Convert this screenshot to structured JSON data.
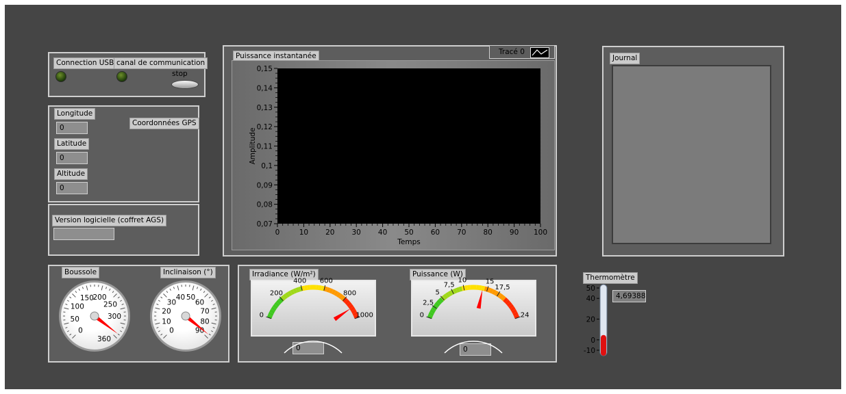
{
  "usb_panel": {
    "usb_label": "Connection USB",
    "channel_label": "canal de communication",
    "stop_label": "stop"
  },
  "gps_panel": {
    "title": "Coordonnées GPS",
    "longitude_label": "Longitude",
    "longitude_value": "0",
    "latitude_label": "Latitude",
    "latitude_value": "0",
    "altitude_label": "Altitude",
    "altitude_value": "0"
  },
  "version_panel": {
    "label": "Version logicielle (coffret AGS)",
    "value": ""
  },
  "compass_panel": {
    "boussole_label": "Boussole",
    "boussole_ticks": [
      "0",
      "50",
      "100",
      "150",
      "200",
      "250",
      "300",
      "360"
    ],
    "boussole_value": 350,
    "inclinaison_label": "Inclinaison (°)",
    "inclinaison_ticks": [
      "0",
      "10",
      "20",
      "30",
      "40",
      "50",
      "60",
      "70",
      "80",
      "90"
    ],
    "inclinaison_value": 88
  },
  "chart_panel": {
    "title": "Puissance instantanée",
    "legend_label": "Tracé 0"
  },
  "chart_data": {
    "type": "line",
    "title": "Puissance instantanée",
    "xlabel": "Temps",
    "ylabel": "Amplitude",
    "xlim": [
      0,
      100
    ],
    "ylim": [
      0.07,
      0.15
    ],
    "x_ticks": [
      "0",
      "10",
      "20",
      "30",
      "40",
      "50",
      "60",
      "70",
      "80",
      "90",
      "100"
    ],
    "y_ticks": [
      "0,15",
      "0,14",
      "0,13",
      "0,12",
      "0,11",
      "0,1",
      "0,09",
      "0,08",
      "0,07"
    ],
    "series": [
      {
        "name": "Tracé 0",
        "values": []
      }
    ],
    "grid": false,
    "legend": "top-right"
  },
  "journal_panel": {
    "label": "Journal"
  },
  "meters_panel": {
    "irradiance_label": "Irradiance (W/m²)",
    "irradiance_ticks": [
      "0",
      "200",
      "400",
      "600",
      "800",
      "1000"
    ],
    "irradiance_needle": 900,
    "irradiance_value": "0",
    "puissance_label": "Puissance (W)",
    "puissance_ticks": [
      "0",
      "2,5",
      "5",
      "7,5",
      "10",
      "15",
      "17,5",
      "24"
    ],
    "puissance_needle": 14,
    "puissance_value": "0"
  },
  "thermo": {
    "label": "Thermomètre",
    "ticks": [
      "50",
      "40",
      "20",
      "0",
      "-10"
    ],
    "value": "4,69388",
    "level": 4.69388
  },
  "colors": {
    "background": "#454545",
    "panel": "#5d5d5d",
    "led_off": "#2d5410",
    "needle": "#ff0000",
    "chart_bg": "#000000"
  }
}
